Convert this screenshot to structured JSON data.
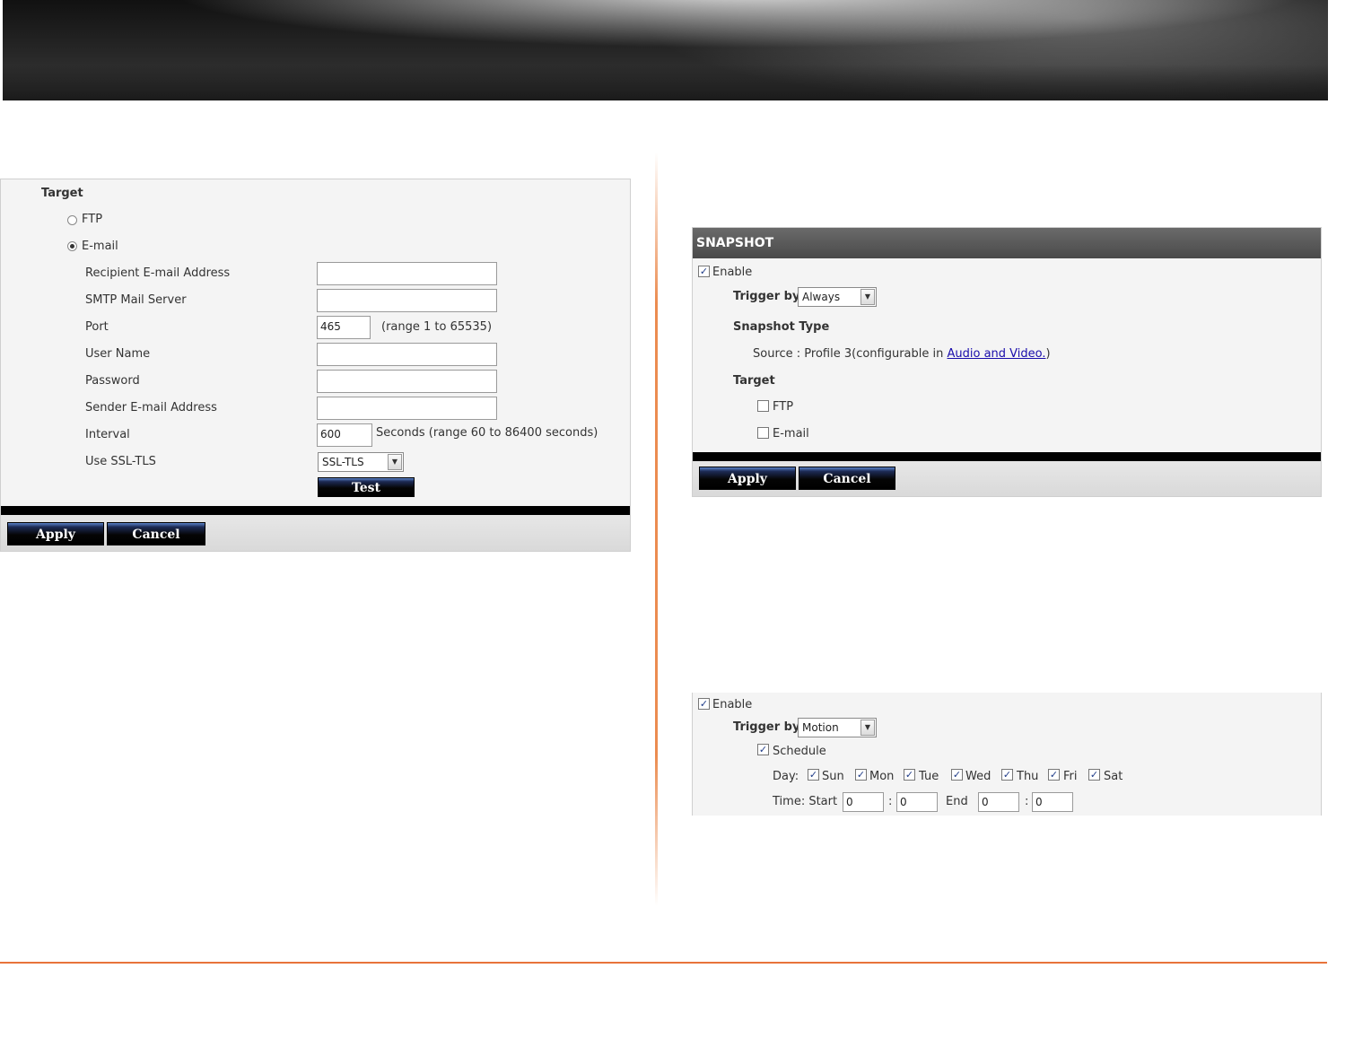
{
  "email_panel": {
    "target_label": "Target",
    "ftp_label": "FTP",
    "email_label": "E-mail",
    "ftp_selected": false,
    "email_selected": true,
    "recipient_label": "Recipient E-mail Address",
    "recipient_value": "",
    "smtp_label": "SMTP Mail Server",
    "smtp_value": "",
    "port_label": "Port",
    "port_value": "465",
    "port_hint": "(range 1 to 65535)",
    "username_label": "User Name",
    "username_value": "",
    "password_label": "Password",
    "password_value": "",
    "sender_label": "Sender E-mail Address",
    "sender_value": "",
    "interval_label": "Interval",
    "interval_value": "600",
    "interval_hint": "Seconds  (range 60 to 86400 seconds)",
    "ssl_label": "Use SSL-TLS",
    "ssl_value": "SSL-TLS",
    "test_button": "Test",
    "apply_button": "Apply",
    "cancel_button": "Cancel"
  },
  "snapshot_panel": {
    "title": "SNAPSHOT",
    "enable_label": "Enable",
    "enable_checked": true,
    "trigger_label": "Trigger by",
    "trigger_value": "Always",
    "type_label": "Snapshot Type",
    "source_text": "Source : Profile 3(configurable in ",
    "source_link": "Audio and Video.",
    "source_close": ")",
    "target_label": "Target",
    "ftp_label": "FTP",
    "email_label": "E-mail",
    "apply_button": "Apply",
    "cancel_button": "Cancel"
  },
  "schedule_panel": {
    "enable_label": "Enable",
    "trigger_label": "Trigger by",
    "trigger_value": "Motion",
    "schedule_label": "Schedule",
    "day_label": "Day:",
    "days": [
      "Sun",
      "Mon",
      "Tue",
      "Wed",
      "Thu",
      "Fri",
      "Sat"
    ],
    "time_label": "Time: Start",
    "start_hour": "0",
    "start_min": "0",
    "end_label": "End",
    "end_hour": "0",
    "end_min": "0",
    "colon": ":"
  },
  "icons": {
    "check": "✓",
    "dropdown": "▼"
  }
}
